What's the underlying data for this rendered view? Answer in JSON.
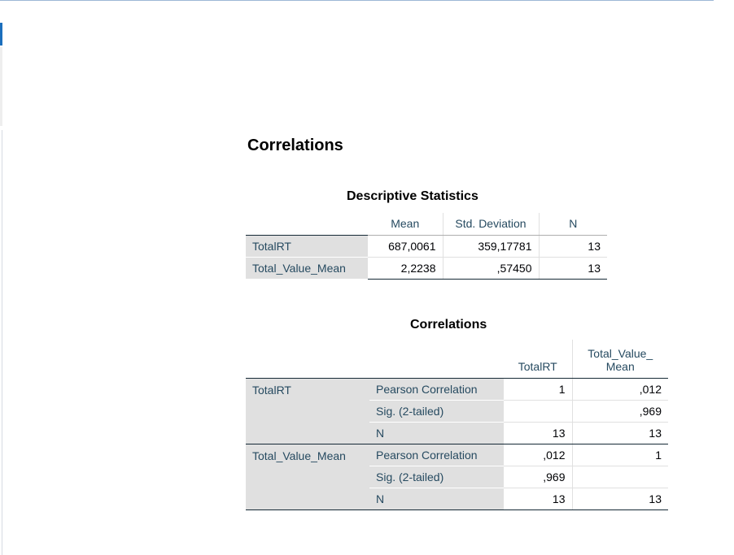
{
  "heading": "Correlations",
  "descriptive": {
    "caption": "Descriptive Statistics",
    "columns": [
      "Mean",
      "Std. Deviation",
      "N"
    ],
    "rows": [
      {
        "label": "TotalRT",
        "mean": "687,0061",
        "std": "359,17781",
        "n": "13"
      },
      {
        "label": "Total_Value_Mean",
        "mean": "2,2238",
        "std": ",57450",
        "n": "13"
      }
    ]
  },
  "correlations": {
    "caption": "Correlations",
    "col1": "TotalRT",
    "col2_line1": "Total_Value_",
    "col2_line2": "Mean",
    "groups": [
      {
        "label": "TotalRT",
        "rows": [
          {
            "stat": "Pearson Correlation",
            "c1": "1",
            "c2": ",012"
          },
          {
            "stat": "Sig. (2-tailed)",
            "c1": "",
            "c2": ",969"
          },
          {
            "stat": "N",
            "c1": "13",
            "c2": "13"
          }
        ]
      },
      {
        "label": "Total_Value_Mean",
        "rows": [
          {
            "stat": "Pearson Correlation",
            "c1": ",012",
            "c2": "1"
          },
          {
            "stat": "Sig. (2-tailed)",
            "c1": ",969",
            "c2": ""
          },
          {
            "stat": "N",
            "c1": "13",
            "c2": "13"
          }
        ]
      }
    ]
  }
}
